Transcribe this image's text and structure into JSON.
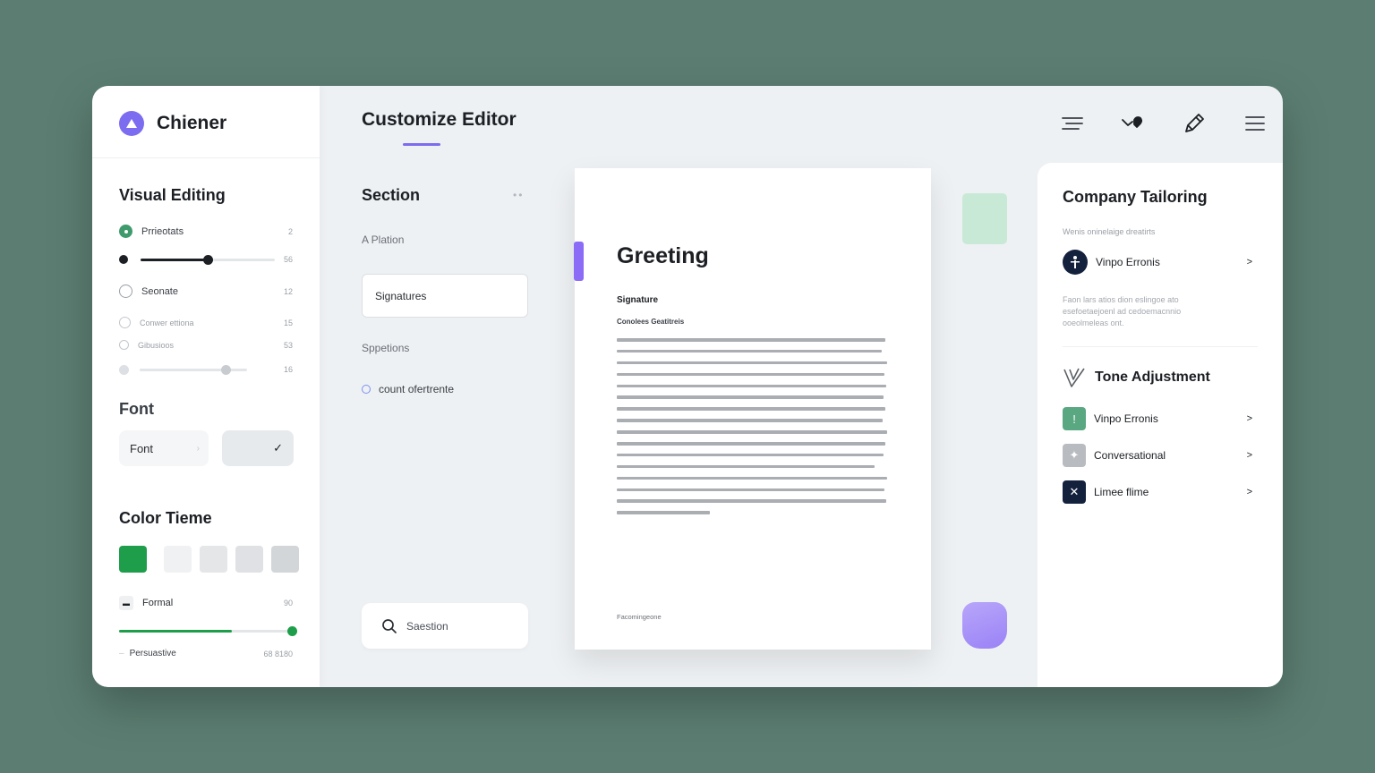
{
  "app": {
    "name": "Chiener"
  },
  "header": {
    "title": "Customize Editor",
    "tools": [
      {
        "icon": "align-lines-icon"
      },
      {
        "icon": "heart-handshake-icon"
      },
      {
        "icon": "pencil-icon"
      },
      {
        "icon": "menu-icon"
      }
    ]
  },
  "sidebar": {
    "visual_heading": "Visual Editing",
    "options": [
      {
        "label": "Prrieotats",
        "value": "2"
      },
      {
        "slider_value": "56"
      },
      {
        "label": "Seonate",
        "value": "12"
      },
      {
        "label": "Conwer ettiona",
        "value": "15"
      },
      {
        "label": "Gibusioos",
        "value": "53"
      },
      {
        "slider_value": "16"
      }
    ],
    "sliders": [
      {
        "level": 0.5
      },
      {
        "level": 0.8
      }
    ],
    "font_heading": "Font",
    "font_label": "Font",
    "font_chevron": "›",
    "font_check": "✓",
    "color_heading": "Color Tieme",
    "swatches": [
      "#1e9e4a",
      "#f0f1f2",
      "#e4e6e8",
      "#dfe1e4",
      "#d3d6d9"
    ],
    "formal_label": "Formal",
    "formal_icon": "▬",
    "formal_value": "90",
    "formal_level": 0.65,
    "persuasive_dash": "–",
    "persuasive_label": "Persuastive",
    "persuasive_value": "68 8180"
  },
  "section": {
    "heading": "Section",
    "dots": "••",
    "sub1": "A Plation",
    "card_label": "Signatures",
    "sub2": "Sppetions",
    "option_label": "count ofertrente",
    "search_placeholder": "Saestion"
  },
  "document": {
    "title": "Greeting",
    "signature": "Signature",
    "subheading": "Conolees Geatitreis",
    "footer": "Facomingeone"
  },
  "right_panel": {
    "heading": "Company Tailoring",
    "sub": "Wenis oninelaige dreatirts",
    "company_item": "Vinpo Erronis",
    "note": "Faon lars atios dion eslingoe ato esefoetaejoenl ad cedoemacnnio ooeolmeleas ont.",
    "tone_heading": "Tone Adjustment",
    "tone_items": [
      {
        "label": "Vinpo Erronis",
        "color": "#5aa882",
        "icon": "!"
      },
      {
        "label": "Conversational",
        "color": "#b8bcc1",
        "icon": "✦"
      },
      {
        "label": "Limee flime",
        "color": "#14213d",
        "icon": "✕"
      }
    ],
    "chevron": ">"
  },
  "colors": {
    "accent": "#7b6cf0",
    "green": "#1e9e4a",
    "navy": "#14213d"
  }
}
